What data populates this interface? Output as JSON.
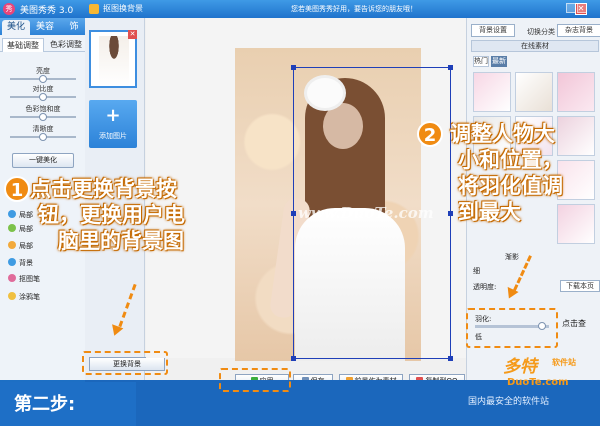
{
  "app": {
    "title": "美图秀秀 3.0",
    "logo_text": "秀",
    "tabs": [
      "美化",
      "美容",
      "饰"
    ],
    "sub_tabs": [
      "基础调整",
      "色彩调整"
    ],
    "sliders": [
      {
        "label": "亮度",
        "value": 0.5
      },
      {
        "label": "对比度",
        "value": 0.5
      },
      {
        "label": "色彩饱和度",
        "value": 0.5
      },
      {
        "label": "清晰度",
        "value": 0.5
      }
    ],
    "one_key_label": "一键美化",
    "tools": [
      {
        "label": "局部",
        "color": "#3f9be2"
      },
      {
        "label": "局部",
        "color": "#7cc24a"
      },
      {
        "label": "局部",
        "color": "#f2a93b"
      },
      {
        "label": "背景",
        "color": "#3f9be2"
      },
      {
        "label": "抠图笔",
        "color": "#e06b9a"
      },
      {
        "label": "涂鸦笔",
        "color": "#f0c040"
      }
    ]
  },
  "dialog": {
    "title": "抠图换背景",
    "promo": "您若美图秀秀好用，要告诉您的朋友哦！",
    "close_glyph": "✕",
    "add_image_glyph": "+",
    "add_image_label": "添加图片",
    "thumb_close_glyph": "✕",
    "replace_bg_label": "更换背景",
    "watermark": "www.DuoTe.com",
    "bottom_buttons": [
      {
        "label": "应用",
        "icon_color": "#3cae3c"
      },
      {
        "label": "保存",
        "icon_color": "#6f8fb8"
      },
      {
        "label": "前景作为素材",
        "icon_color": "#f0a030"
      },
      {
        "label": "复制到QQ",
        "icon_color": "#e05050"
      }
    ]
  },
  "right_panel": {
    "bg_settings_label": "背景设置",
    "switch_category_label": "切换分类",
    "switch_category_value": "杂志背景",
    "online_tab_label": "在线素材",
    "categories": [
      "热门",
      "最新"
    ],
    "fade_label": "渐影",
    "blur_label": "细",
    "opacity_label": "透明度:",
    "download_label": "下载本页",
    "feather_label": "羽化:",
    "feather_value": 0.9,
    "low_label": "低",
    "click_label": "点击查"
  },
  "annotations": {
    "step1_number": "1",
    "step1_text": [
      "点击更换背景按",
      "钮，更换用户电",
      "脑里的背景图"
    ],
    "step2_number": "2",
    "step2_text": [
      "调整人物大",
      "小和位置，",
      "将羽化值调",
      "到最大"
    ]
  },
  "footer": {
    "step_label": "第二步:",
    "site_name": "多特",
    "site_small": "软件站",
    "site_url": "DuoTe.com",
    "site_tagline": "国内最安全的软件站"
  }
}
